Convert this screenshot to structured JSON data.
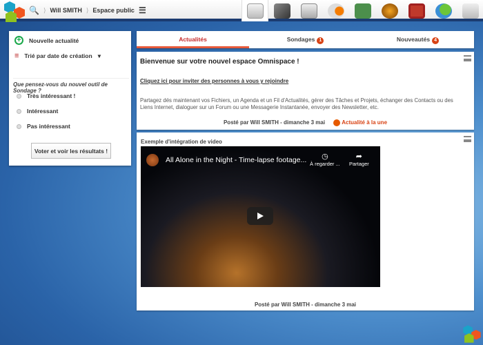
{
  "header": {
    "user": "Will SMITH",
    "space": "Espace public"
  },
  "apps": [
    "news",
    "files",
    "calendar",
    "announcements",
    "contacts",
    "links",
    "tasks",
    "messenger",
    "mail"
  ],
  "sidebar": {
    "new_post": "Nouvelle actualité",
    "sort": "Trié par date de création",
    "poll_question": "Que pensez-vous du nouvel outil de Sondage ?",
    "options": [
      "Très intéressant !",
      "Intéressant",
      "Pas intéressant"
    ],
    "vote_button": "Voter et voir les résultats !"
  },
  "tabs": [
    {
      "label": "Actualités"
    },
    {
      "label": "Sondages",
      "badge": "1"
    },
    {
      "label": "Nouveautés",
      "badge": "4"
    }
  ],
  "post1": {
    "title": "Bienvenue sur votre nouvel espace Omnispace !",
    "invite_link": "Cliquez ici pour inviter des personnes à vous y rejoindre",
    "body": "Partagez dés maintenant vos Fichiers, un Agenda et un Fil d'Actualités, gérer des Tâches et Projets, échanger des Contacts ou des Liens Internet, dialoguer sur un Forum ou une Messagerie Instantanée, envoyer des Newsletter, etc.",
    "footer": "Posté par Will SMITH - dimanche 3 mai",
    "featured": "Actualité à la une"
  },
  "post2": {
    "title": "Exemple d'intégration de video",
    "video_title": "All Alone in the Night - Time-lapse footage...",
    "watch_later": "À regarder ...",
    "share": "Partager",
    "footer": "Posté par Will SMITH - dimanche 3 mai"
  }
}
